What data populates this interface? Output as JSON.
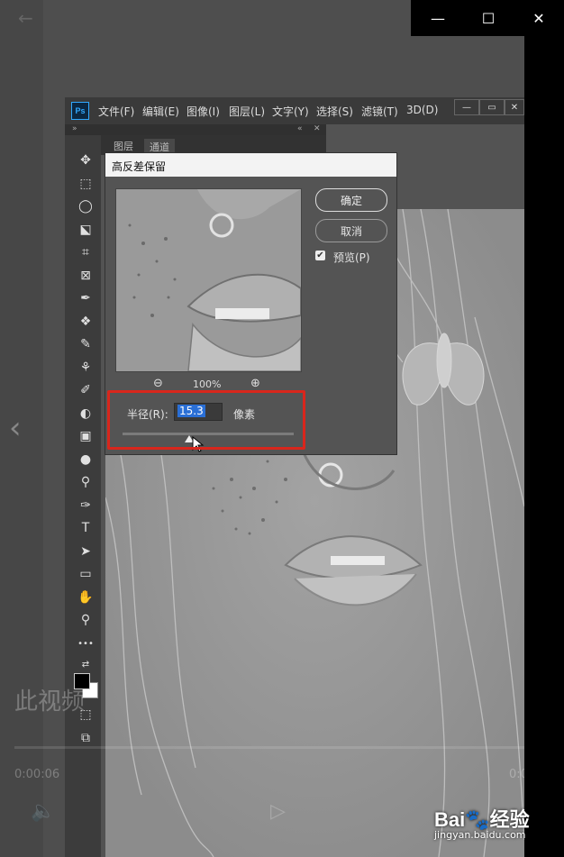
{
  "window": {
    "minimize_label": "—",
    "maximize_label": "☐",
    "close_label": "✕",
    "back_label": "←"
  },
  "photoshop": {
    "logo": "Ps",
    "menu": [
      "文件(F)",
      "编辑(E)",
      "图像(I)",
      "图层(L)",
      "文字(Y)",
      "选择(S)",
      "滤镜(T)",
      "3D(D)"
    ],
    "panel_collapse": "»",
    "panel_menu": "«",
    "panel_close": "✕",
    "tabs": [
      "图层",
      "通道"
    ],
    "tools": [
      "✥",
      "⬚",
      "◯",
      "⬕",
      "⌗",
      "⊠",
      "✒",
      "❖",
      "✎",
      "⚘",
      "✐",
      "◐",
      "▣",
      "●",
      "⚲",
      "✑",
      "T",
      "➤",
      "▭",
      "✋",
      "⚲",
      "•••",
      "⇄",
      "■",
      "⬚",
      "⧉"
    ]
  },
  "dialog": {
    "title": "高反差保留",
    "ok_label": "确定",
    "cancel_label": "取消",
    "preview_checkbox": "✔",
    "preview_label": "预览(P)",
    "zoom_out_icon": "⊖",
    "zoom_level": "100%",
    "zoom_in_icon": "⊕",
    "radius_label": "半径(R):",
    "radius_value": "15.3",
    "radius_unit": "像素",
    "slider_position": 0.39
  },
  "video_overlay": {
    "watermark": "此视频",
    "time_left": "0:00:06",
    "time_right": "0:00:15",
    "left_arrow": "‹",
    "right_arrow": "›"
  },
  "brand": {
    "logo": "Bai🐾经验",
    "url": "jingyan.baidu.com"
  },
  "colors": {
    "highlight_border": "#d9261c",
    "selection": "#2a6fd6",
    "ps_accent": "#31a8ff"
  }
}
